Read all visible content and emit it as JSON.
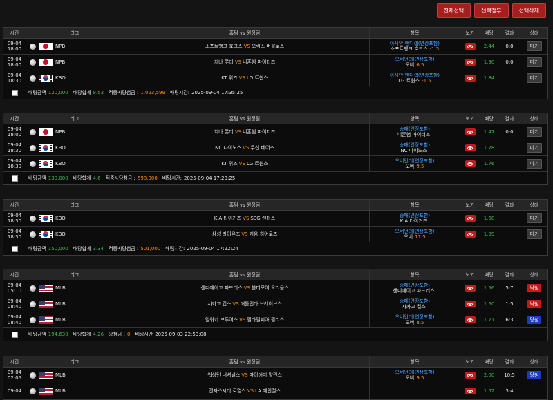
{
  "topbar": {
    "select_all": "전체선택",
    "select_cancel": "선택정부",
    "select_delete": "선택삭제"
  },
  "headers": {
    "time": "시간",
    "league": "리그",
    "match": "홈팀 vs 원정팀",
    "pick": "항목",
    "view": "보기",
    "odds": "배당",
    "result": "결과",
    "status": "상태"
  },
  "vs_text": "VS",
  "slips": [
    {
      "rows": [
        {
          "date": "09-04",
          "time": "18:00",
          "flag": "jp",
          "league": "NPB",
          "home": "소프트뱅크 호크스",
          "away": "오릭스 버팔로스",
          "market": "아시안 핸디캡(연장포함)",
          "sel": "소프트뱅크 호크스",
          "line": "-1.5",
          "odds": "2.44",
          "result": "0:0",
          "status": "미기",
          "status_type": "pending"
        },
        {
          "date": "09-04",
          "time": "18:00",
          "flag": "jp",
          "league": "NPB",
          "home": "치바 롯데",
          "away": "니혼햄 파이터즈",
          "market": "오버언더(연장포함)",
          "sel": "오버",
          "line": "6.5",
          "odds": "1.90",
          "result": "0:0",
          "status": "미기",
          "status_type": "pending"
        },
        {
          "date": "09-04",
          "time": "18:30",
          "flag": "kr",
          "league": "KBO",
          "home": "KT 위즈",
          "away": "LG 트윈스",
          "market": "아시안 핸디캡(연장포함)",
          "sel": "LG 트윈스",
          "line": "-1.5",
          "odds": "1.84",
          "result": "",
          "status": "미기",
          "status_type": "pending"
        }
      ],
      "footer": {
        "amount_label": "배팅금액",
        "amount": "120,000",
        "total_odds_label": "배당합계",
        "total_odds": "8.53",
        "payout_label": "적중시당첨금 :",
        "payout": "1,023,599",
        "time_label": "배팅시간:",
        "time": "2025-09-04 17:35:25"
      }
    },
    {
      "rows": [
        {
          "date": "09-04",
          "time": "18:00",
          "flag": "jp",
          "league": "NPB",
          "home": "치바 롯데",
          "away": "니혼햄 파이터즈",
          "market": "승패(연장포함)",
          "sel": "니혼햄 파이터즈",
          "line": "",
          "odds": "1.47",
          "result": "0:0",
          "status": "미기",
          "status_type": "pending"
        },
        {
          "date": "09-04",
          "time": "18:30",
          "flag": "kr",
          "league": "KBO",
          "home": "NC 다이노스",
          "away": "두산 베어스",
          "market": "승패(연장포함)",
          "sel": "NC 다이노스",
          "line": "",
          "odds": "1.78",
          "result": "",
          "status": "미기",
          "status_type": "pending"
        },
        {
          "date": "09-04",
          "time": "18:30",
          "flag": "kr",
          "league": "KBO",
          "home": "KT 위즈",
          "away": "LG 트윈스",
          "market": "오버언더(연장포함)",
          "sel": "오버",
          "line": "9.5",
          "odds": "1.76",
          "result": "",
          "status": "미기",
          "status_type": "pending"
        }
      ],
      "footer": {
        "amount_label": "배팅금액",
        "amount": "130,000",
        "total_odds_label": "배당합계",
        "total_odds": "4.6",
        "payout_label": "적중시당첨금 :",
        "payout": "598,000",
        "time_label": "배팅시간:",
        "time": "2025-09-04 17:23:25"
      }
    },
    {
      "rows": [
        {
          "date": "09-04",
          "time": "18:30",
          "flag": "kr",
          "league": "KBO",
          "home": "KIA 타이거즈",
          "away": "SSG 랜더스",
          "market": "승패(연장포함)",
          "sel": "KIA 타이거즈",
          "line": "",
          "odds": "1.68",
          "result": "",
          "status": "미기",
          "status_type": "pending"
        },
        {
          "date": "09-04",
          "time": "18:30",
          "flag": "kr",
          "league": "KBO",
          "home": "삼성 라이온즈",
          "away": "키움 히어로즈",
          "market": "오버언더(연장포함)",
          "sel": "오버",
          "line": "11.5",
          "odds": "1.99",
          "result": "",
          "status": "미기",
          "status_type": "pending"
        }
      ],
      "footer": {
        "amount_label": "배팅금액",
        "amount": "150,000",
        "total_odds_label": "배당합계",
        "total_odds": "3.34",
        "payout_label": "적중시당첨금 :",
        "payout": "501,000",
        "time_label": "배팅시간:",
        "time": "2025-09-04 17:22:24"
      }
    },
    {
      "rows": [
        {
          "date": "09-04",
          "time": "05:10",
          "flag": "us",
          "league": "MLB",
          "home": "샌디에이고 파드리스",
          "away": "볼티모어 오리올스",
          "market": "승패(연장포함)",
          "sel": "샌디에이고 파드리스",
          "line": "",
          "odds": "1.56",
          "result": "5:7",
          "status": "낙첨",
          "status_type": "lost"
        },
        {
          "date": "09-04",
          "time": "08:40",
          "flag": "us",
          "league": "MLB",
          "home": "시카고 컵스",
          "away": "애틀랜타 브레이브스",
          "market": "승패(연장포함)",
          "sel": "시카고 컵스",
          "line": "",
          "odds": "1.60",
          "result": "1:5",
          "status": "낙첨",
          "status_type": "lost"
        },
        {
          "date": "09-04",
          "time": "08:40",
          "flag": "us",
          "league": "MLB",
          "home": "밀워키 브루어스",
          "away": "필라델피아 필리스",
          "market": "오버언더(연장포함)",
          "sel": "오버",
          "line": "8.5",
          "odds": "1.71",
          "result": "6:3",
          "status": "당첨",
          "status_type": "won"
        }
      ],
      "footer": {
        "amount_label": "배팅금액",
        "amount": "194,630",
        "total_odds_label": "배당합계",
        "total_odds": "4.26",
        "payout_label": "당첨금 :",
        "payout": "0",
        "time_label": "배팅시간",
        "time": "2025-09-03 22:53:08"
      }
    },
    {
      "rows": [
        {
          "date": "09-04",
          "time": "02:05",
          "flag": "us",
          "league": "MLB",
          "home": "워싱턴 내셔널스",
          "away": "마이애미 말린스",
          "market": "오버언더(연장포함)",
          "sel": "오버",
          "line": "9.5",
          "odds": "2.00",
          "result": "10:5",
          "status": "당첨",
          "status_type": "won"
        },
        {
          "date": "09-04",
          "time": "",
          "flag": "us",
          "league": "MLB",
          "home": "캔자스시티 로열스",
          "away": "LA 에인절스",
          "market": "",
          "sel": "",
          "line": "",
          "odds": "1.52",
          "result": "3:4",
          "status": "",
          "status_type": "pending"
        }
      ],
      "footer": null
    }
  ]
}
